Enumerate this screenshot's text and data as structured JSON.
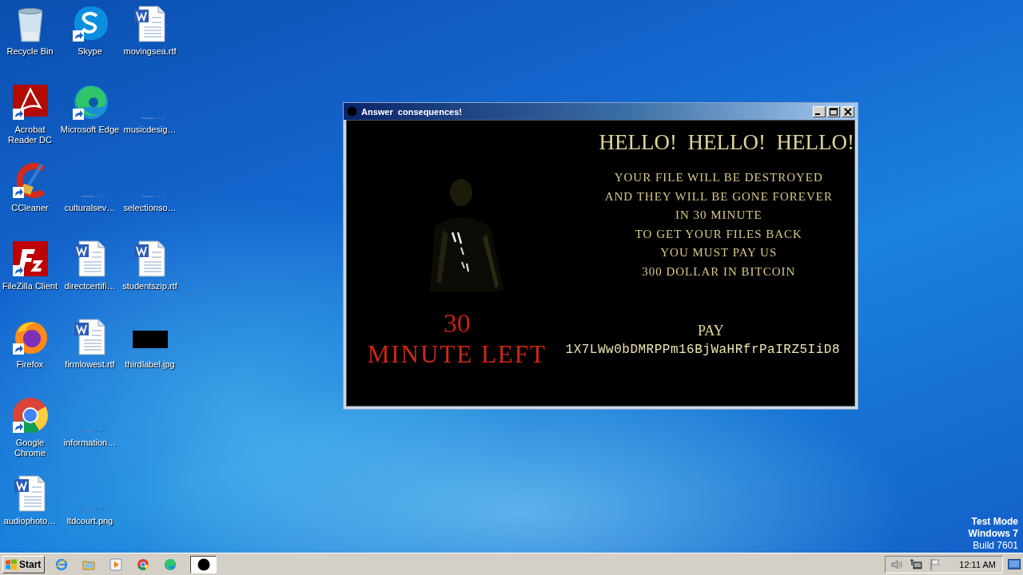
{
  "desktop_icons": [
    {
      "label": "Recycle Bin",
      "kind": "recycle-bin",
      "shortcut": false
    },
    {
      "label": "Acrobat Reader DC",
      "kind": "acrobat",
      "shortcut": true
    },
    {
      "label": "CCleaner",
      "kind": "ccleaner",
      "shortcut": true
    },
    {
      "label": "FileZilla Client",
      "kind": "filezilla",
      "shortcut": true
    },
    {
      "label": "Firefox",
      "kind": "firefox",
      "shortcut": true
    },
    {
      "label": "Google Chrome",
      "kind": "chrome",
      "shortcut": true
    },
    {
      "label": "audiophoto…",
      "kind": "word-doc",
      "shortcut": false
    },
    {
      "label": "Skype",
      "kind": "skype",
      "shortcut": true
    },
    {
      "label": "Microsoft Edge",
      "kind": "edge",
      "shortcut": true
    },
    {
      "label": "culturalsev…",
      "kind": "blank-file",
      "shortcut": false
    },
    {
      "label": "directcertifi…",
      "kind": "word-doc",
      "shortcut": false
    },
    {
      "label": "firmlowest.rtf",
      "kind": "word-doc",
      "shortcut": false
    },
    {
      "label": "information…",
      "kind": "blank-file",
      "shortcut": false
    },
    {
      "label": "ltdcourt.png",
      "kind": "blank-file",
      "shortcut": false
    },
    {
      "label": "movingsea.rtf",
      "kind": "word-doc",
      "shortcut": false
    },
    {
      "label": "musicdesig…",
      "kind": "blank-file",
      "shortcut": false
    },
    {
      "label": "selectionso…",
      "kind": "blank-file",
      "shortcut": false
    },
    {
      "label": "studentszip.rtf",
      "kind": "word-doc",
      "shortcut": false
    },
    {
      "label": "thirdlabel.jpg",
      "kind": "black-image",
      "shortcut": false
    }
  ],
  "window": {
    "title": "Answer  consequences!",
    "countdown": "30",
    "countdown_label": "MINUTE LEFT",
    "heading": "HELLO!  HELLO!  HELLO!",
    "message_lines": [
      "YOUR FILE WILL BE DESTROYED",
      "AND THEY WILL BE GONE FOREVER",
      "IN 30 MINUTE",
      "TO GET YOUR FILES BACK",
      "YOU MUST PAY US",
      "300 DOLLAR IN BITCOIN"
    ],
    "pay_label": "PAY",
    "address": "1X7LWw0bDMRPPm16BjWaHRfrPaIRZ5IiD8"
  },
  "desktop_status": [
    {
      "text": "Test Mode",
      "bold": true
    },
    {
      "text": "Windows 7",
      "bold": true
    },
    {
      "text": "Build 7601",
      "bold": false
    }
  ],
  "taskbar": {
    "start": "Start",
    "quick_launch": [
      {
        "kind": "ie"
      },
      {
        "kind": "folder"
      },
      {
        "kind": "media"
      },
      {
        "kind": "chrome"
      },
      {
        "kind": "edge"
      }
    ],
    "tasks": [
      {
        "kind": "black-circle",
        "selected": true
      }
    ],
    "tray_icons": [
      {
        "kind": "volume"
      },
      {
        "kind": "network"
      },
      {
        "kind": "flag"
      }
    ],
    "clock": "12:11 AM"
  }
}
